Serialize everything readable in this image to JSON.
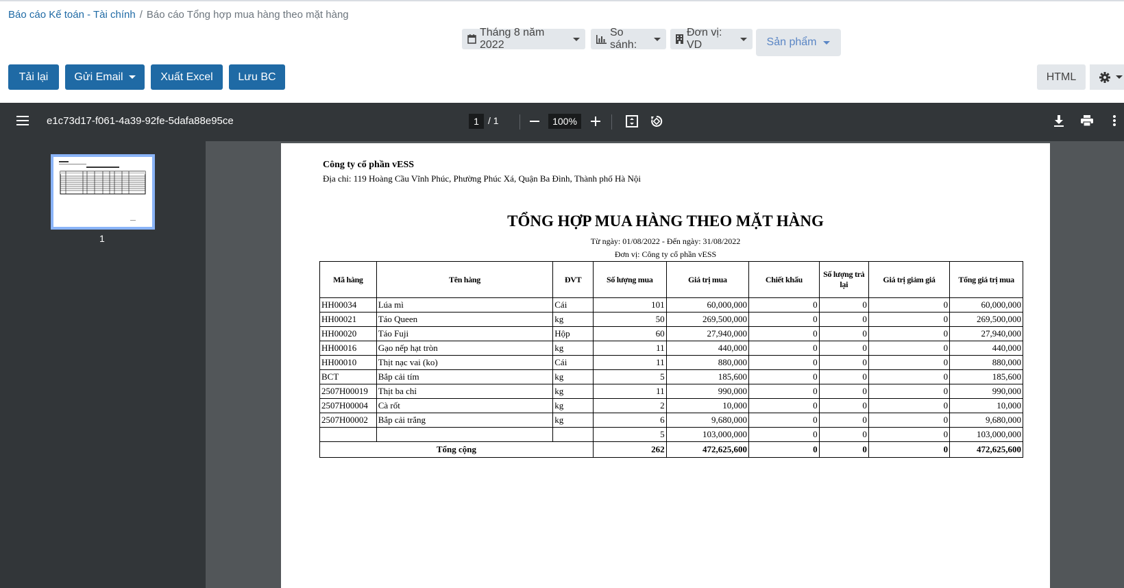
{
  "breadcrumb": {
    "root": "Báo cáo Kế toán - Tài chính",
    "current": "Báo cáo Tổng hợp mua hàng theo mặt hàng"
  },
  "filters": {
    "period": "Tháng 8 năm 2022",
    "compare": "So sánh:",
    "unit": "Đơn vị: VD",
    "product": "Sản phẩm"
  },
  "toolbar": {
    "reload": "Tải lại",
    "send_email": "Gửi Email",
    "export_excel": "Xuất Excel",
    "save": "Lưu BC",
    "html": "HTML"
  },
  "viewer": {
    "filename": "e1c73d17-f061-4a39-92fe-5dafa88e95ce",
    "page_current": "1",
    "page_total": "/  1",
    "zoom": "100%",
    "thumb_page": "1"
  },
  "report": {
    "company": "Công ty cổ phần vESS",
    "address": "Địa chỉ: 119 Hoàng Cầu Vĩnh Phúc, Phường Phúc Xá, Quận Ba Đình, Thành phố Hà Nội",
    "title": "TỔNG HỢP MUA HÀNG THEO MẶT HÀNG",
    "date_range": "Từ ngày: 01/08/2022 - Đến ngày: 31/08/2022",
    "unit": "Đơn vị: Công ty cổ phần vESS",
    "columns": [
      "Mã hàng",
      "Tên hàng",
      "ĐVT",
      "Số lượng mua",
      "Giá trị mua",
      "Chiết khấu",
      "Số lượng trả lại",
      "Giá trị giảm giá",
      "Tổng giá trị mua"
    ],
    "rows": [
      [
        "HH00034",
        "Lúa mì",
        "Cái",
        "101",
        "60,000,000",
        "0",
        "0",
        "0",
        "60,000,000"
      ],
      [
        "HH00021",
        "Táo Queen",
        "kg",
        "50",
        "269,500,000",
        "0",
        "0",
        "0",
        "269,500,000"
      ],
      [
        "HH00020",
        "Táo Fuji",
        "Hộp",
        "60",
        "27,940,000",
        "0",
        "0",
        "0",
        "27,940,000"
      ],
      [
        "HH00016",
        "Gạo nếp hạt tròn",
        "kg",
        "11",
        "440,000",
        "0",
        "0",
        "0",
        "440,000"
      ],
      [
        "HH00010",
        "Thịt nạc vai (ko)",
        "Cái",
        "11",
        "880,000",
        "0",
        "0",
        "0",
        "880,000"
      ],
      [
        "BCT",
        "Bắp cải tím",
        "kg",
        "5",
        "185,600",
        "0",
        "0",
        "0",
        "185,600"
      ],
      [
        "2507H00019",
        "Thịt ba chỉ",
        "kg",
        "11",
        "990,000",
        "0",
        "0",
        "0",
        "990,000"
      ],
      [
        "2507H00004",
        "Cà rốt",
        "kg",
        "2",
        "10,000",
        "0",
        "0",
        "0",
        "10,000"
      ],
      [
        "2507H00002",
        "Bắp cải trắng",
        "kg",
        "6",
        "9,680,000",
        "0",
        "0",
        "0",
        "9,680,000"
      ],
      [
        "",
        "",
        "",
        "5",
        "103,000,000",
        "0",
        "0",
        "0",
        "103,000,000"
      ]
    ],
    "total": {
      "label": "Tổng cộng",
      "values": [
        "262",
        "472,625,600",
        "0",
        "0",
        "0",
        "472,625,600"
      ]
    }
  }
}
